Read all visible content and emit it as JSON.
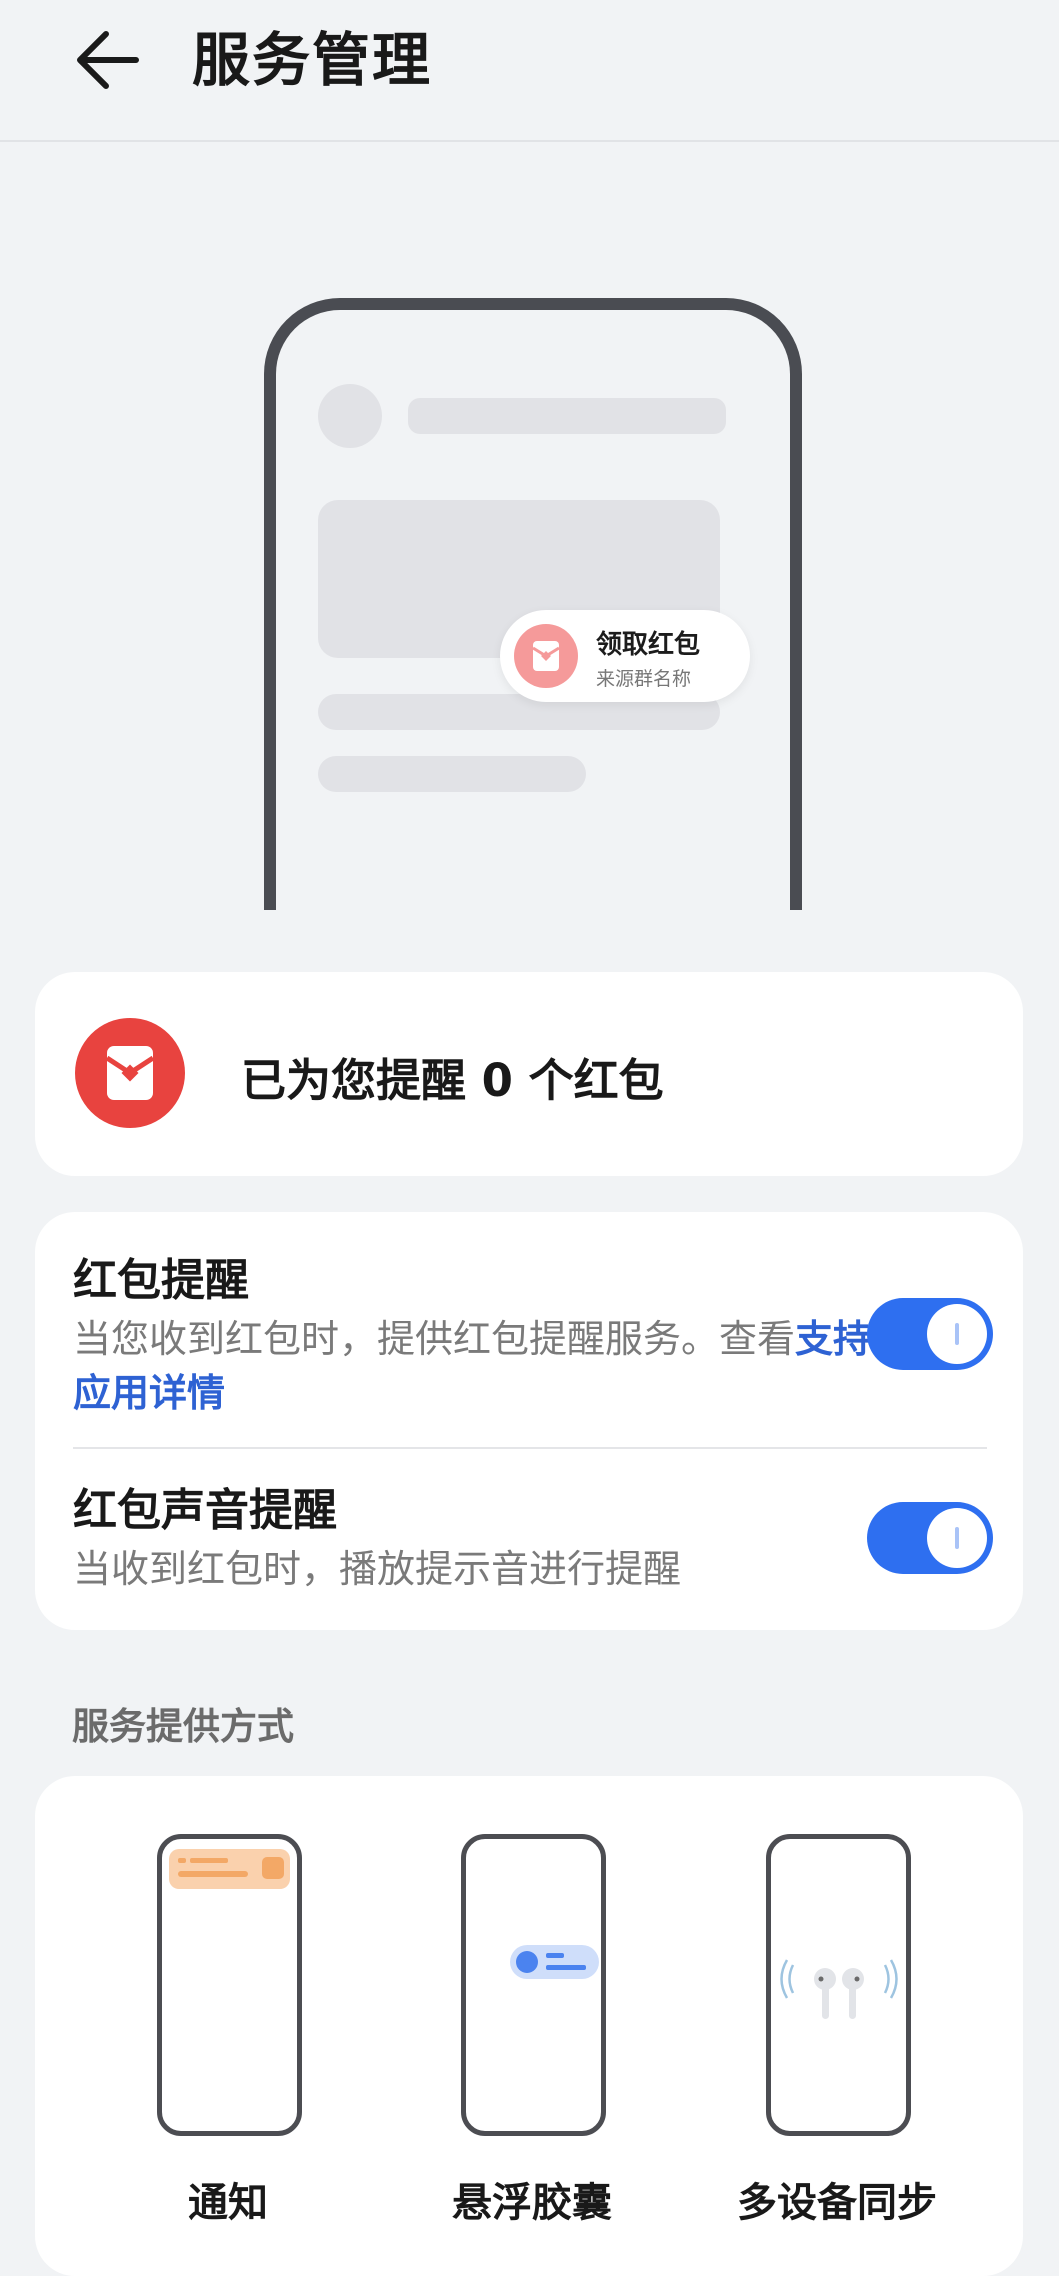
{
  "header": {
    "title": "服务管理"
  },
  "illustration": {
    "notification_title": "领取红包",
    "notification_subtitle": "来源群名称"
  },
  "summary": {
    "text": "已为您提醒 0 个红包"
  },
  "settings": {
    "red_packet_reminder": {
      "title": "红包提醒",
      "desc_prefix": "当您收到红包时，提供红包提醒服务。查看",
      "link": "支持应用详情",
      "enabled": true
    },
    "sound_reminder": {
      "title": "红包声音提醒",
      "desc": "当收到红包时，播放提示音进行提醒",
      "enabled": true
    }
  },
  "section": {
    "title": "服务提供方式"
  },
  "modes": [
    {
      "label": "通知",
      "icon": "notification-banner-icon"
    },
    {
      "label": "悬浮胶囊",
      "icon": "floating-capsule-icon"
    },
    {
      "label": "多设备同步",
      "icon": "earbuds-icon"
    }
  ],
  "colors": {
    "accent": "#2e6ff0",
    "link": "#2e62d3",
    "red": "#e8433f",
    "background": "#f1f3f5"
  }
}
